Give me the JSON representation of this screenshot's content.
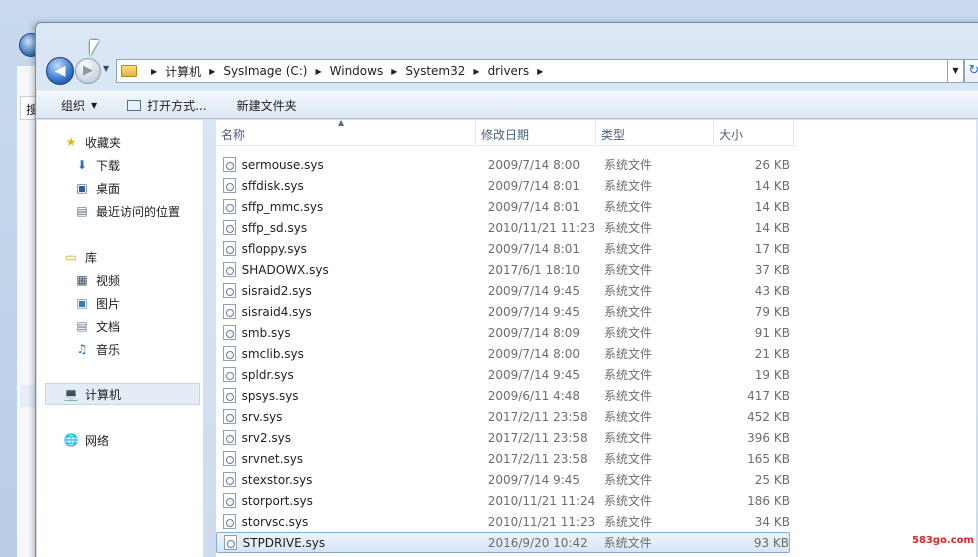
{
  "background_window": {
    "search_char": "搜"
  },
  "nav": {
    "breadcrumbs": [
      "计算机",
      "SysImage (C:)",
      "Windows",
      "System32",
      "drivers"
    ]
  },
  "toolbar": {
    "organize": "组织",
    "open_with": "打开方式...",
    "new_folder": "新建文件夹"
  },
  "navpane": {
    "favorites": "收藏夹",
    "downloads": "下载",
    "desktop": "桌面",
    "recent": "最近访问的位置",
    "libraries": "库",
    "videos": "视频",
    "pictures": "图片",
    "documents": "文档",
    "music": "音乐",
    "computer": "计算机",
    "network": "网络"
  },
  "columns": {
    "name": "名称",
    "date": "修改日期",
    "type": "类型",
    "size": "大小"
  },
  "files": [
    {
      "name": "sermouse.sys",
      "date": "2009/7/14 8:00",
      "type": "系统文件",
      "size": "26 KB"
    },
    {
      "name": "sffdisk.sys",
      "date": "2009/7/14 8:01",
      "type": "系统文件",
      "size": "14 KB"
    },
    {
      "name": "sffp_mmc.sys",
      "date": "2009/7/14 8:01",
      "type": "系统文件",
      "size": "14 KB"
    },
    {
      "name": "sffp_sd.sys",
      "date": "2010/11/21 11:23",
      "type": "系统文件",
      "size": "14 KB"
    },
    {
      "name": "sfloppy.sys",
      "date": "2009/7/14 8:01",
      "type": "系统文件",
      "size": "17 KB"
    },
    {
      "name": "SHADOWX.sys",
      "date": "2017/6/1 18:10",
      "type": "系统文件",
      "size": "37 KB"
    },
    {
      "name": "sisraid2.sys",
      "date": "2009/7/14 9:45",
      "type": "系统文件",
      "size": "43 KB"
    },
    {
      "name": "sisraid4.sys",
      "date": "2009/7/14 9:45",
      "type": "系统文件",
      "size": "79 KB"
    },
    {
      "name": "smb.sys",
      "date": "2009/7/14 8:09",
      "type": "系统文件",
      "size": "91 KB"
    },
    {
      "name": "smclib.sys",
      "date": "2009/7/14 8:00",
      "type": "系统文件",
      "size": "21 KB"
    },
    {
      "name": "spldr.sys",
      "date": "2009/7/14 9:45",
      "type": "系统文件",
      "size": "19 KB"
    },
    {
      "name": "spsys.sys",
      "date": "2009/6/11 4:48",
      "type": "系统文件",
      "size": "417 KB"
    },
    {
      "name": "srv.sys",
      "date": "2017/2/11 23:58",
      "type": "系统文件",
      "size": "452 KB"
    },
    {
      "name": "srv2.sys",
      "date": "2017/2/11 23:58",
      "type": "系统文件",
      "size": "396 KB"
    },
    {
      "name": "srvnet.sys",
      "date": "2017/2/11 23:58",
      "type": "系统文件",
      "size": "165 KB"
    },
    {
      "name": "stexstor.sys",
      "date": "2009/7/14 9:45",
      "type": "系统文件",
      "size": "25 KB"
    },
    {
      "name": "storport.sys",
      "date": "2010/11/21 11:24",
      "type": "系统文件",
      "size": "186 KB"
    },
    {
      "name": "storvsc.sys",
      "date": "2010/11/21 11:23",
      "type": "系统文件",
      "size": "34 KB"
    },
    {
      "name": "STPDRIVE.sys",
      "date": "2016/9/20 10:42",
      "type": "系统文件",
      "size": "93 KB",
      "selected": true
    }
  ],
  "watermark": "583go.com"
}
